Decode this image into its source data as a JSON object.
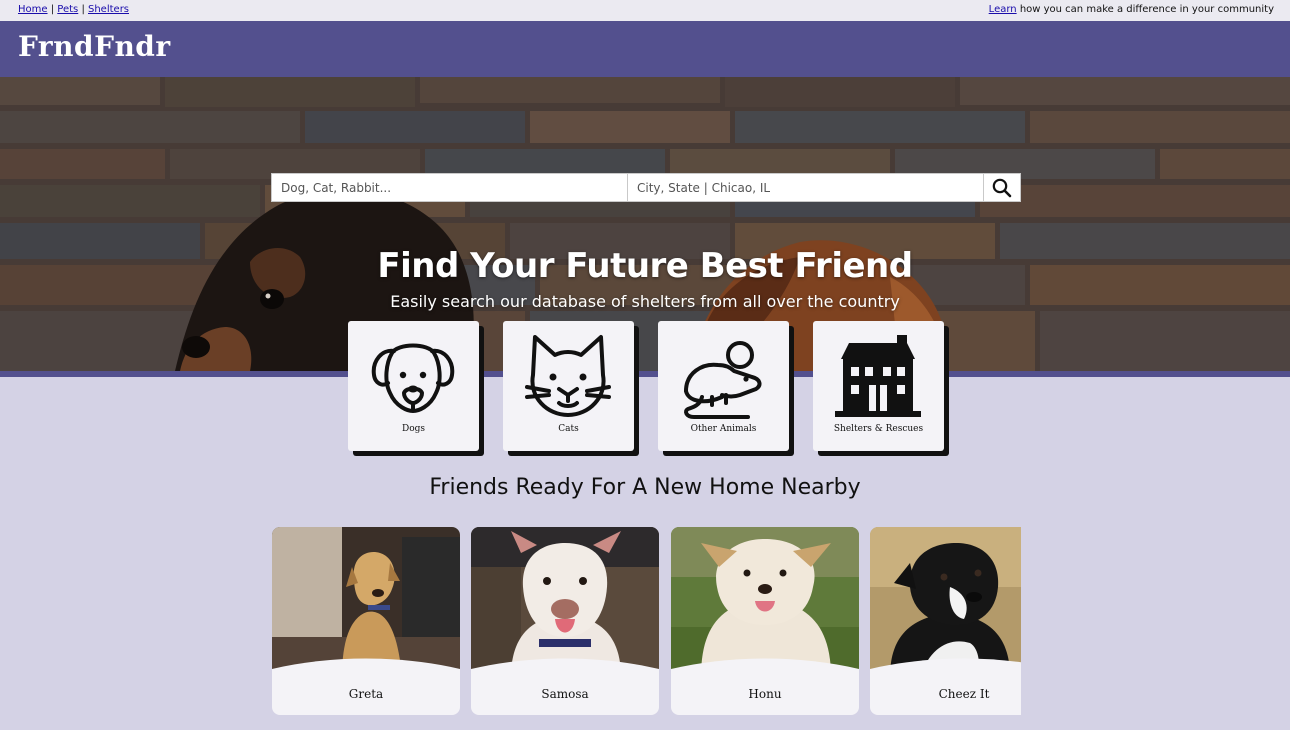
{
  "topbar": {
    "links": [
      "Home",
      "Pets",
      "Shelters"
    ],
    "separator": "|",
    "promo_link": "Learn",
    "promo_text": "how you can make a difference in your community"
  },
  "header": {
    "logo": "FrndFndr"
  },
  "search": {
    "query_placeholder": "Dog, Cat, Rabbit...",
    "location_placeholder": "City, State | Chicao, IL",
    "button_icon": "search-icon"
  },
  "hero": {
    "title": "Find Your Future Best Friend",
    "subtitle": "Easily search our database of shelters from all over the country"
  },
  "categories": [
    {
      "label": "Dogs",
      "icon": "dog-icon"
    },
    {
      "label": "Cats",
      "icon": "cat-icon"
    },
    {
      "label": "Other Animals",
      "icon": "mouse-icon"
    },
    {
      "label": "Shelters & Rescues",
      "icon": "building-icon"
    }
  ],
  "nearby": {
    "title": "Friends Ready For A New Home Nearby",
    "pets": [
      {
        "name": "Greta"
      },
      {
        "name": "Samosa"
      },
      {
        "name": "Honu"
      },
      {
        "name": "Cheez It"
      }
    ]
  },
  "colors": {
    "brand_purple": "#53508e",
    "page_background": "#d4d2e5",
    "card_background": "#f4f3f7",
    "topbar_background": "#ebeaf1"
  }
}
